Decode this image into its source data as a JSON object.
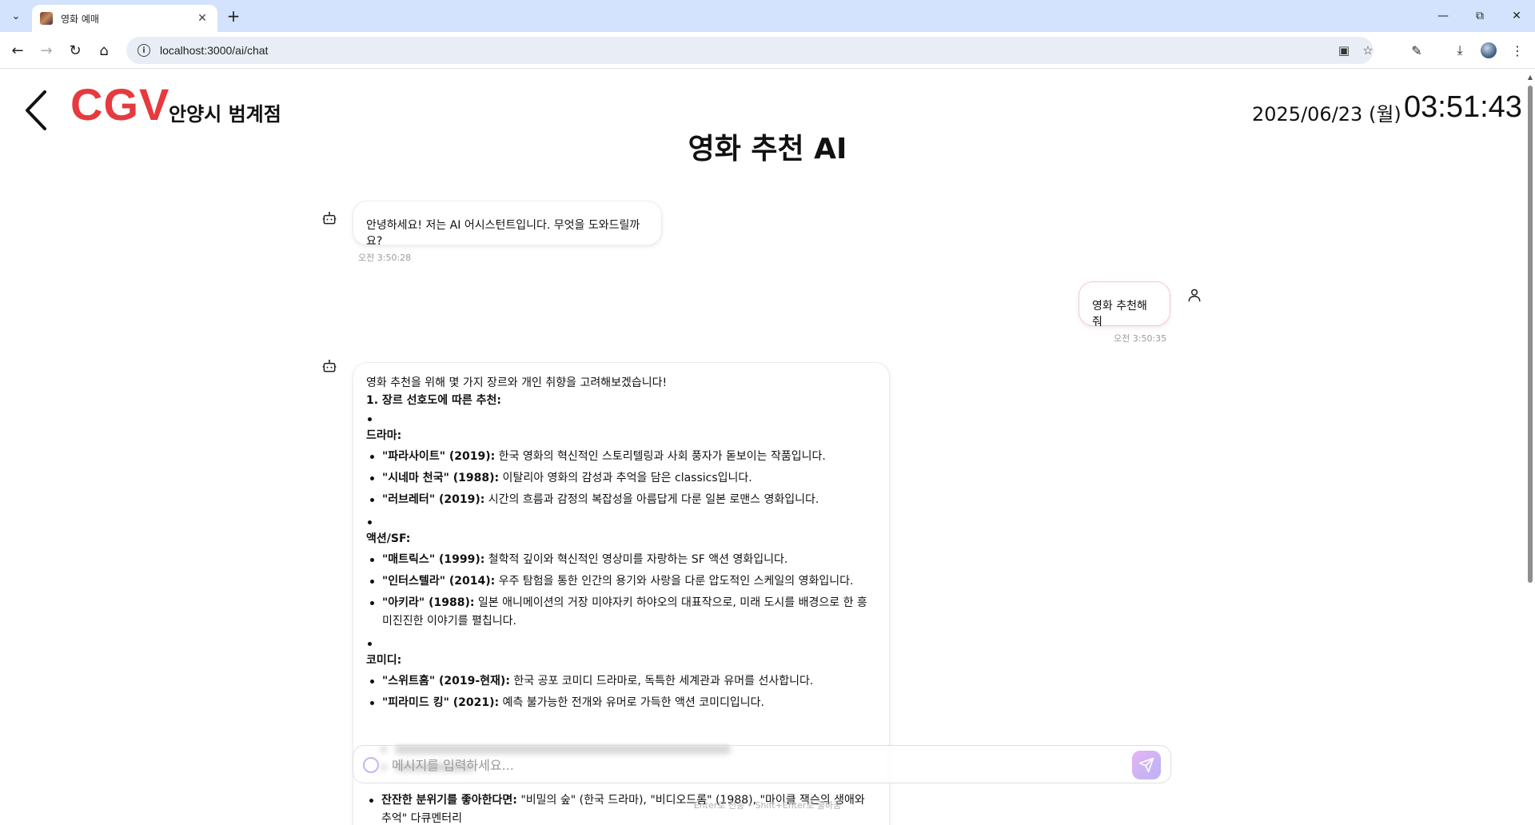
{
  "browser": {
    "tab_title": "영화 예매",
    "url": "localhost:3000/ai/chat"
  },
  "header": {
    "brand": "CGV",
    "branch": "안양시 범계점",
    "date": "2025/06/23 (월)",
    "time": "03:51:43",
    "title": "영화 추천 AI"
  },
  "messages": {
    "greeting": {
      "text": "안녕하세요! 저는 AI 어시스턴트입니다. 무엇을 도와드릴까요?",
      "time": "오전 3:50:28"
    },
    "user": {
      "text": "영화 추천해줘",
      "time": "오전 3:50:35"
    },
    "reply": {
      "intro": "영화 추천을 위해 몇 가지 장르와 개인 취향을 고려해보겠습니다!",
      "section_title": "1. 장르 선호도에 따른 추천:",
      "genres": [
        {
          "name": "드라마:",
          "items": [
            {
              "title": "\"파라사이트\" (2019):",
              "desc": " 한국 영화의 혁신적인 스토리텔링과 사회 풍자가 돋보이는 작품입니다."
            },
            {
              "title": "\"시네마 천국\" (1988):",
              "desc": " 이탈리아 영화의 감성과 추억을 담은 classics입니다."
            },
            {
              "title": "\"러브레터\" (2019):",
              "desc": " 시간의 흐름과 감정의 복잡성을 아름답게 다룬 일본 로맨스 영화입니다."
            }
          ]
        },
        {
          "name": "액션/SF:",
          "items": [
            {
              "title": "\"매트릭스\" (1999):",
              "desc": " 철학적 깊이와 혁신적인 영상미를 자랑하는 SF 액션 영화입니다."
            },
            {
              "title": "\"인터스텔라\" (2014):",
              "desc": " 우주 탐험을 통한 인간의 용기와 사랑을 다룬 압도적인 스케일의 영화입니다."
            },
            {
              "title": "\"아키라\" (1988):",
              "desc": " 일본 애니메이션의 거장 미야자키 하야오의 대표작으로, 미래 도시를 배경으로 한 흥미진진한 이야기를 펼칩니다."
            }
          ]
        },
        {
          "name": "코미디:",
          "items": [
            {
              "title": "\"스위트홈\" (2019-현재):",
              "desc": " 한국 공포 코미디 드라마로, 독특한 세계관과 유머를 선사합니다."
            },
            {
              "title": "\"피라미드 킹\" (2021):",
              "desc": " 예측 불가능한 전개와 유머로 가득한 액션 코미디입니다."
            }
          ]
        }
      ],
      "after_item": {
        "title": "잔잔한 분위기를 좋아한다면:",
        "desc": " \"비밀의 숲\" (한국 드라마), \"비디오드롬\" (1988), \"마이클 잭슨의 생애와 추억\" 다큐멘터리"
      }
    }
  },
  "input": {
    "placeholder": "메시지를 입력하세요...",
    "hint": "Enter로 전송 • Shift+Enter로 줄바꿈"
  }
}
